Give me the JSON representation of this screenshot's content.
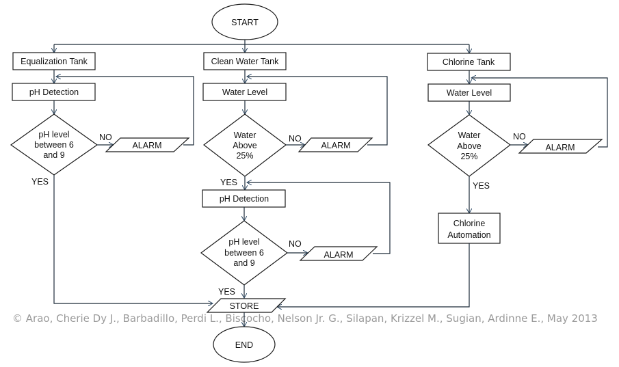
{
  "diagram": {
    "type": "flowchart",
    "terminals": {
      "start": "START",
      "end": "END"
    },
    "columns": [
      {
        "id": "equalization",
        "tank": "Equalization Tank",
        "process": "pH Detection",
        "decision": [
          "pH level",
          "between 6",
          "and 9"
        ],
        "no_label": "NO",
        "yes_label": "YES",
        "alarm": "ALARM"
      },
      {
        "id": "clean",
        "tank": "Clean Water Tank",
        "process": "Water Level",
        "decision": [
          "Water",
          "Above",
          "25%"
        ],
        "no_label": "NO",
        "yes_label": "YES",
        "alarm": "ALARM",
        "process2": "pH Detection",
        "decision2": [
          "pH level",
          "between 6",
          "and 9"
        ],
        "no_label2": "NO",
        "yes_label2": "YES",
        "alarm2": "ALARM"
      },
      {
        "id": "chlorine",
        "tank": "Chlorine Tank",
        "process": "Water Level",
        "decision": [
          "Water",
          "Above",
          "25%"
        ],
        "no_label": "NO",
        "yes_label": "YES",
        "alarm": "ALARM",
        "action": [
          "Chlorine",
          "Automation"
        ]
      }
    ],
    "store": "STORE",
    "copyright": "© Arao, Cherie Dy J., Barbadillo, Perdi L., Biscocho, Nelson Jr. G., Silapan, Krizzel M., Sugian, Ardinne E., May 2013"
  },
  "colors": {
    "line": "#1c2a38",
    "copyright_text": "#9a9a9a"
  }
}
